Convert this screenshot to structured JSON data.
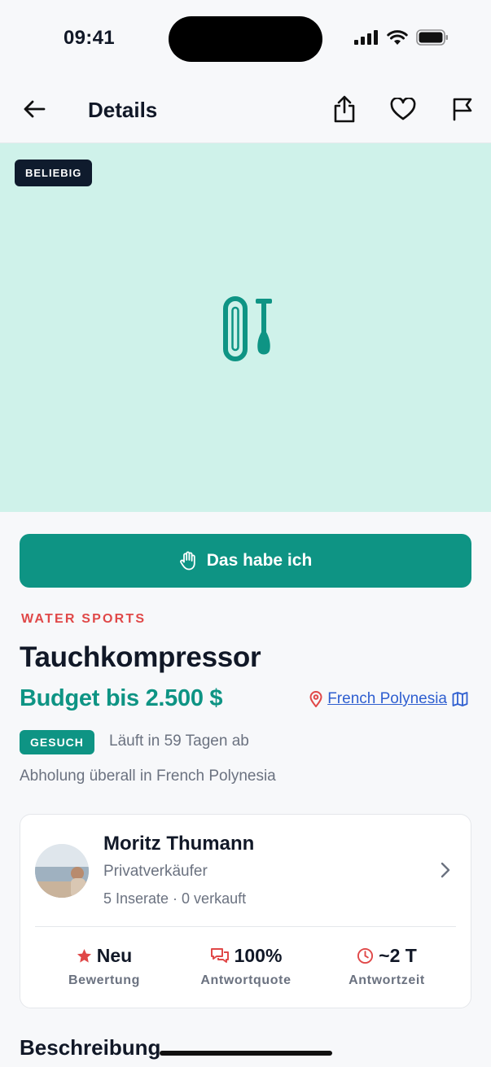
{
  "status_bar": {
    "time": "09:41"
  },
  "nav": {
    "title": "Details"
  },
  "hero": {
    "badge": "BELIEBIG",
    "bg_color": "#cff2ea",
    "icon": "paddle-board-icon"
  },
  "cta": {
    "label": "Das habe ich",
    "icon": "hand-icon",
    "color": "#0e9484"
  },
  "listing": {
    "category": "WATER SPORTS",
    "title": "Tauchkompressor",
    "budget": "Budget bis 2.500 $",
    "location": "French Polynesia",
    "type_badge": "GESUCH",
    "expiry": "Läuft in 59 Tagen ab",
    "pickup": "Abholung überall in French Polynesia"
  },
  "seller": {
    "name": "Moritz Thumann",
    "type": "Privatverkäufer",
    "listings": "5 Inserate · 0 verkauft",
    "stats": [
      {
        "value": "Neu",
        "label": "Bewertung",
        "icon": "star-icon"
      },
      {
        "value": "100%",
        "label": "Antwortquote",
        "icon": "chat-icon"
      },
      {
        "value": "~2 T",
        "label": "Antwortzeit",
        "icon": "clock-icon"
      }
    ]
  },
  "sections": {
    "description_title": "Beschreibung"
  },
  "colors": {
    "accent": "#0e9484",
    "category": "#e04848",
    "link": "#2f5fd0",
    "badge_dark": "#0f1b2d"
  }
}
